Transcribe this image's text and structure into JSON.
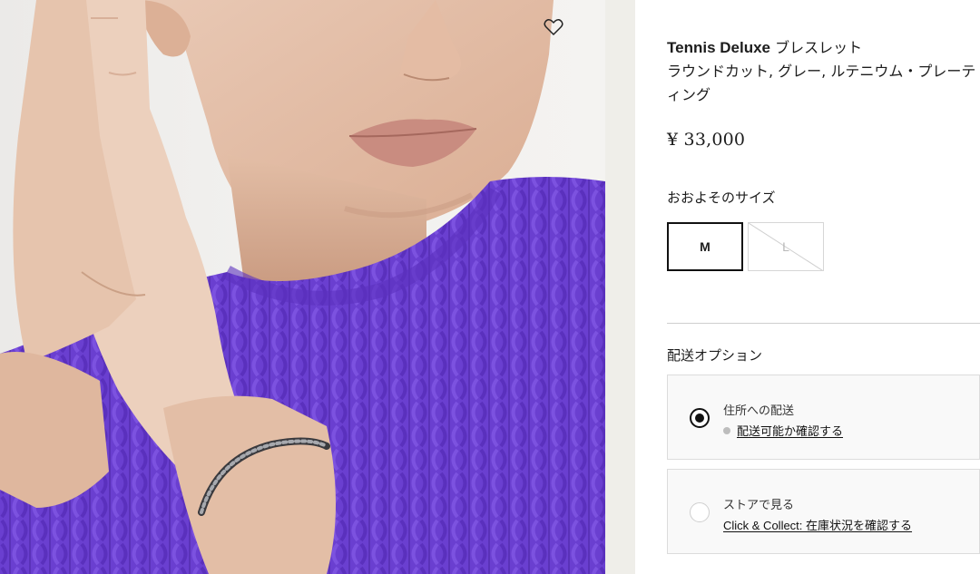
{
  "product": {
    "brand_name": "Tennis Deluxe",
    "title_suffix": "ブレスレット",
    "subtitle": "ラウンドカット, グレー, ルテニウム・プレーティング",
    "price": "¥ 33,000"
  },
  "wishlist": {
    "icon": "heart-outline-icon"
  },
  "size": {
    "label": "おおよそのサイズ",
    "options": [
      {
        "label": "M",
        "selected": true,
        "available": true
      },
      {
        "label": "L",
        "selected": false,
        "available": false
      }
    ]
  },
  "shipping": {
    "label": "配送オプション",
    "options": [
      {
        "title": "住所への配送",
        "link": "配送可能か確認する",
        "selected": true
      },
      {
        "title": "ストアで見る",
        "link": "Click & Collect: 在庫状況を確認する",
        "selected": false
      }
    ]
  },
  "colors": {
    "sweater": "#6a3fd0",
    "text": "#1c1c1c",
    "border": "#dcdcdc",
    "card_bg": "#f9f9f9"
  }
}
